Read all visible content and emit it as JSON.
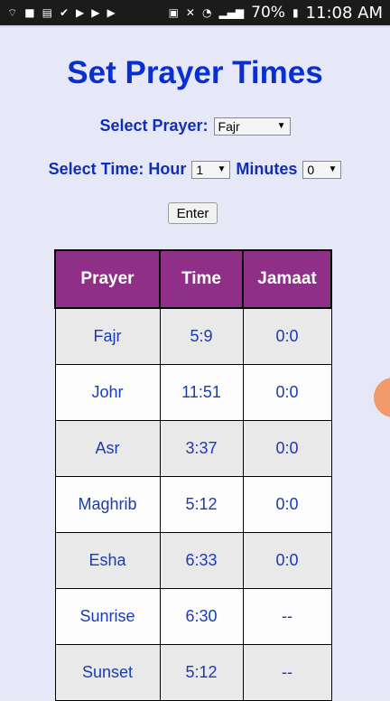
{
  "status_bar": {
    "battery_percent": "70%",
    "time": "11:08 AM",
    "left_icons": [
      "wifi-icon",
      "camera-icon",
      "news-icon",
      "check-icon",
      "play-icon",
      "play-check-icon",
      "play-store-icon"
    ],
    "right_icons": [
      "sim-icon",
      "mute-icon",
      "alarm-icon",
      "signal-icon",
      "battery-icon"
    ]
  },
  "page": {
    "title": "Set Prayer Times",
    "select_prayer_label": "Select Prayer:",
    "prayer_value": "Fajr",
    "select_time_label": "Select Time: Hour",
    "hour_value": "1",
    "minutes_label": "Minutes",
    "minutes_value": "0",
    "enter_label": "Enter"
  },
  "table": {
    "headers": [
      "Prayer",
      "Time",
      "Jamaat"
    ],
    "rows": [
      [
        "Fajr",
        "5:9",
        "0:0"
      ],
      [
        "Johr",
        "11:51",
        "0:0"
      ],
      [
        "Asr",
        "3:37",
        "0:0"
      ],
      [
        "Maghrib",
        "5:12",
        "0:0"
      ],
      [
        "Esha",
        "6:33",
        "0:0"
      ],
      [
        "Sunrise",
        "6:30",
        "--"
      ],
      [
        "Sunset",
        "5:12",
        "--"
      ]
    ]
  },
  "colors": {
    "title": "#0a2fd1",
    "header_bg": "#8f2f87",
    "cell_text": "#1b3bb0",
    "background": "#e6e7f7"
  }
}
